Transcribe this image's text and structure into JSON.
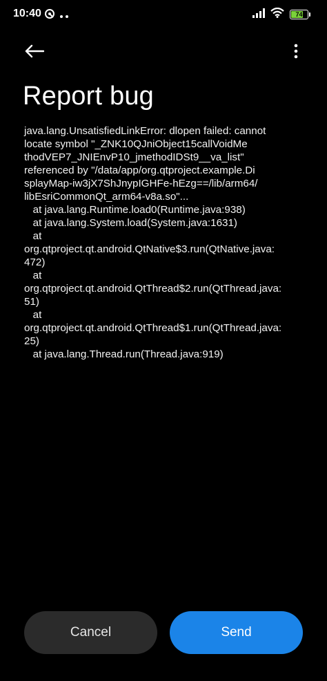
{
  "status_bar": {
    "time": "10:40",
    "battery_level": "74",
    "battery_fraction": 0.74,
    "battery_color": "#7bd23a",
    "icons": [
      "hotspot-icon",
      "more-dots-icon",
      "signal-icon",
      "wifi-icon",
      "battery-icon"
    ]
  },
  "top_bar": {
    "back_icon": "arrow-left-icon",
    "more_icon": "more-vertical-icon"
  },
  "page": {
    "title": "Report bug",
    "error_lines": [
      "java.lang.UnsatisfiedLinkError: dlopen failed: cannot",
      "locate symbol \"_ZNK10QJniObject15callVoidMe",
      "thodVEP7_JNIEnvP10_jmethodIDSt9__va_list\"",
      "referenced by \"/data/app/org.qtproject.example.Di",
      "splayMap-iw3jX7ShJnypIGHFe-hEzg==/lib/arm64/",
      "libEsriCommonQt_arm64-v8a.so\"...",
      "   at java.lang.Runtime.load0(Runtime.java:938)",
      "   at java.lang.System.load(System.java:1631)",
      "   at",
      "org.qtproject.qt.android.QtNative$3.run(QtNative.java:",
      "472)",
      "   at",
      "org.qtproject.qt.android.QtThread$2.run(QtThread.java:",
      "51)",
      "   at",
      "org.qtproject.qt.android.QtThread$1.run(QtThread.java:",
      "25)",
      "   at java.lang.Thread.run(Thread.java:919)"
    ]
  },
  "actions": {
    "cancel_label": "Cancel",
    "send_label": "Send",
    "send_color": "#1b84e8",
    "cancel_color": "#2b2b2b"
  }
}
